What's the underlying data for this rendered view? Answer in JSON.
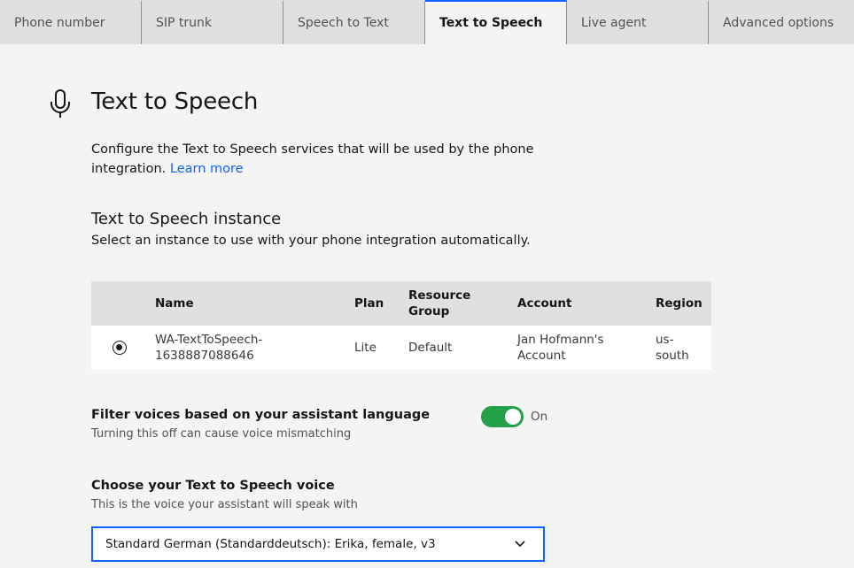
{
  "tabs": [
    {
      "label": "Phone number"
    },
    {
      "label": "SIP trunk"
    },
    {
      "label": "Speech to Text"
    },
    {
      "label": "Text to Speech"
    },
    {
      "label": "Live agent"
    },
    {
      "label": "Advanced options"
    }
  ],
  "active_tab": "Text to Speech",
  "header": {
    "icon": "microphone-icon",
    "title": "Text to Speech"
  },
  "description": {
    "text": "Configure the Text to Speech services that will be used by the phone integration.",
    "link_label": "Learn more"
  },
  "instance_section": {
    "title": "Text to Speech instance",
    "subtitle": "Select an instance to use with your phone integration automatically.",
    "columns": [
      "Name",
      "Plan",
      "Resource Group",
      "Account",
      "Region"
    ],
    "rows": [
      {
        "selected": true,
        "name": "WA-TextToSpeech-1638887088646",
        "plan": "Lite",
        "group": "Default",
        "account": "Jan Hofmann's Account",
        "region": "us-south"
      }
    ]
  },
  "filter": {
    "title": "Filter voices based on your assistant language",
    "subtitle": "Turning this off can cause voice mismatching",
    "state_label": "On",
    "enabled": true
  },
  "voice": {
    "title": "Choose your Text to Speech voice",
    "subtitle": "This is the voice your assistant will speak with",
    "selected": "Standard German (Standarddeutsch): Erika, female, v3"
  },
  "colors": {
    "accent": "#0f62fe",
    "toggle_on": "#24a148",
    "tab_bg": "#e0e0e0",
    "page_bg": "#f4f4f4"
  }
}
